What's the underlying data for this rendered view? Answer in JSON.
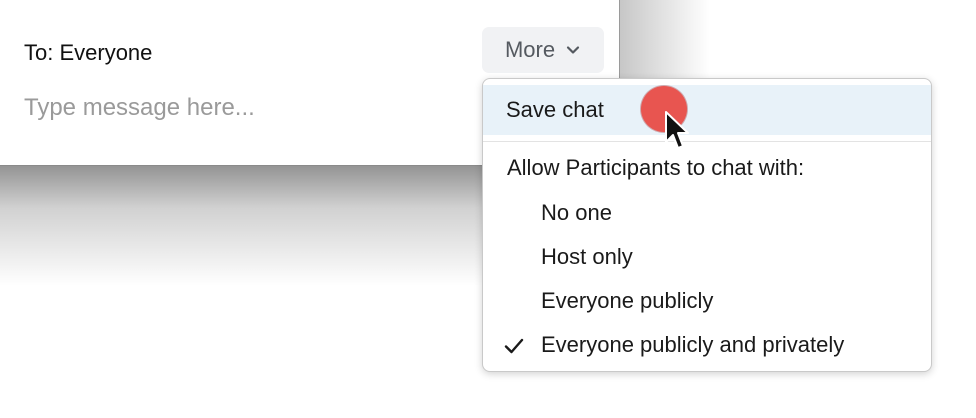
{
  "chat": {
    "to_label": "To: Everyone",
    "more_label": "More",
    "message_placeholder": "Type message here..."
  },
  "more_menu": {
    "save_chat": "Save chat",
    "allow_label": "Allow Participants to chat with:",
    "options": [
      {
        "label": "No one",
        "checked": false
      },
      {
        "label": "Host only",
        "checked": false
      },
      {
        "label": "Everyone publicly",
        "checked": false
      },
      {
        "label": "Everyone publicly and privately",
        "checked": true
      }
    ]
  },
  "icons": {
    "more_chevron": "chevron-down-icon",
    "checked_option": "checkmark-icon",
    "pointer": "mouse-pointer-icon"
  },
  "colors": {
    "highlight": "#e8f2f9",
    "more_button_bg": "#f1f2f4",
    "cursor_highlight": "#e85550"
  }
}
